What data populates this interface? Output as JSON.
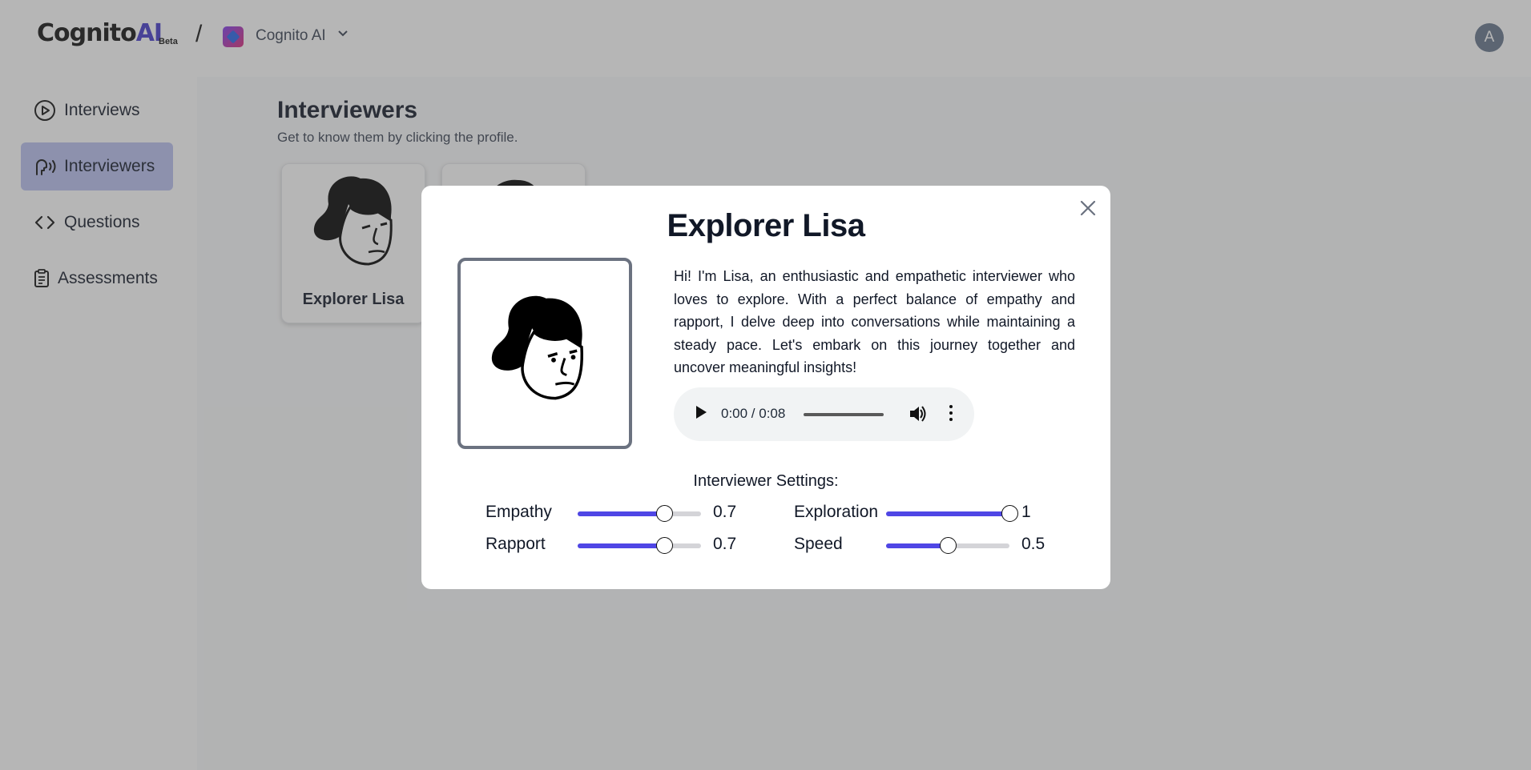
{
  "header": {
    "brand_main": "Cognito",
    "brand_accent": "AI",
    "brand_badge": "Beta",
    "separator": "/",
    "org_name": "Cognito AI",
    "org_caret": "⌄",
    "avatar_initial": "A"
  },
  "sidebar": {
    "items": [
      {
        "label": "Interviews",
        "icon": "play-circle-icon",
        "active": false
      },
      {
        "label": "Interviewers",
        "icon": "speaking-head-icon",
        "active": true
      },
      {
        "label": "Questions",
        "icon": "code-brackets-icon",
        "active": false
      },
      {
        "label": "Assessments",
        "icon": "clipboard-icon",
        "active": false
      }
    ]
  },
  "main": {
    "title": "Interviewers",
    "subtitle": "Get to know them by clicking the profile.",
    "cards": [
      {
        "name": "Explorer Lisa"
      },
      {
        "name": ""
      }
    ]
  },
  "modal": {
    "title": "Explorer Lisa",
    "close_icon": "×",
    "description": "Hi! I'm Lisa, an enthusiastic and empathetic interviewer who loves to explore. With a perfect balance of empathy and rapport, I delve deep into conversations while maintaining a steady pace. Let's embark on this journey together and uncover meaningful insights!",
    "audio": {
      "time": "0:00 / 0:08",
      "progress": 0
    },
    "settings_title": "Interviewer Settings:",
    "settings": [
      {
        "label": "Empathy",
        "value": "0.7",
        "level": 0.7
      },
      {
        "label": "Exploration",
        "value": "1",
        "level": 1.0
      },
      {
        "label": "Rapport",
        "value": "0.7",
        "level": 0.7
      },
      {
        "label": "Speed",
        "value": "0.5",
        "level": 0.5
      }
    ]
  },
  "colors": {
    "accent": "#4f46e5",
    "brand_accent": "#4338ca",
    "active_nav": "#b8c0f0",
    "overlay": "rgba(80,80,80,0.42)"
  }
}
